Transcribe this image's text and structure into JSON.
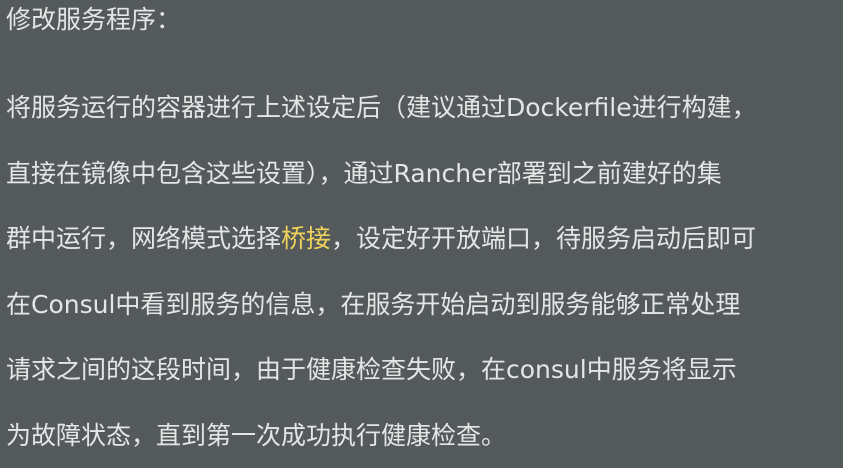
{
  "heading": "修改服务程序：",
  "paragraph": {
    "lines": [
      {
        "before": "将服务运行的容器进行上述设定后（建议通过Dockerfile进行构建，",
        "highlight": "",
        "after": ""
      },
      {
        "before": "直接在镜像中包含这些设置），通过Rancher部署到之前建好的集",
        "highlight": "",
        "after": ""
      },
      {
        "before": "群中运行，网络模式选择",
        "highlight": "桥接",
        "after": "，设定好开放端口，待服务启动后即可"
      },
      {
        "before": "在Consul中看到服务的信息，在服务开始启动到服务能够正常处理",
        "highlight": "",
        "after": ""
      },
      {
        "before": "请求之间的这段时间，由于健康检查失败，在consul中服务将显示",
        "highlight": "",
        "after": ""
      },
      {
        "before": "为故障状态，直到第一次成功执行健康检查。",
        "highlight": "",
        "after": ""
      }
    ]
  },
  "colors": {
    "background": "#545a5c",
    "text": "#e4e6e6",
    "highlight": "#f2d35a"
  }
}
